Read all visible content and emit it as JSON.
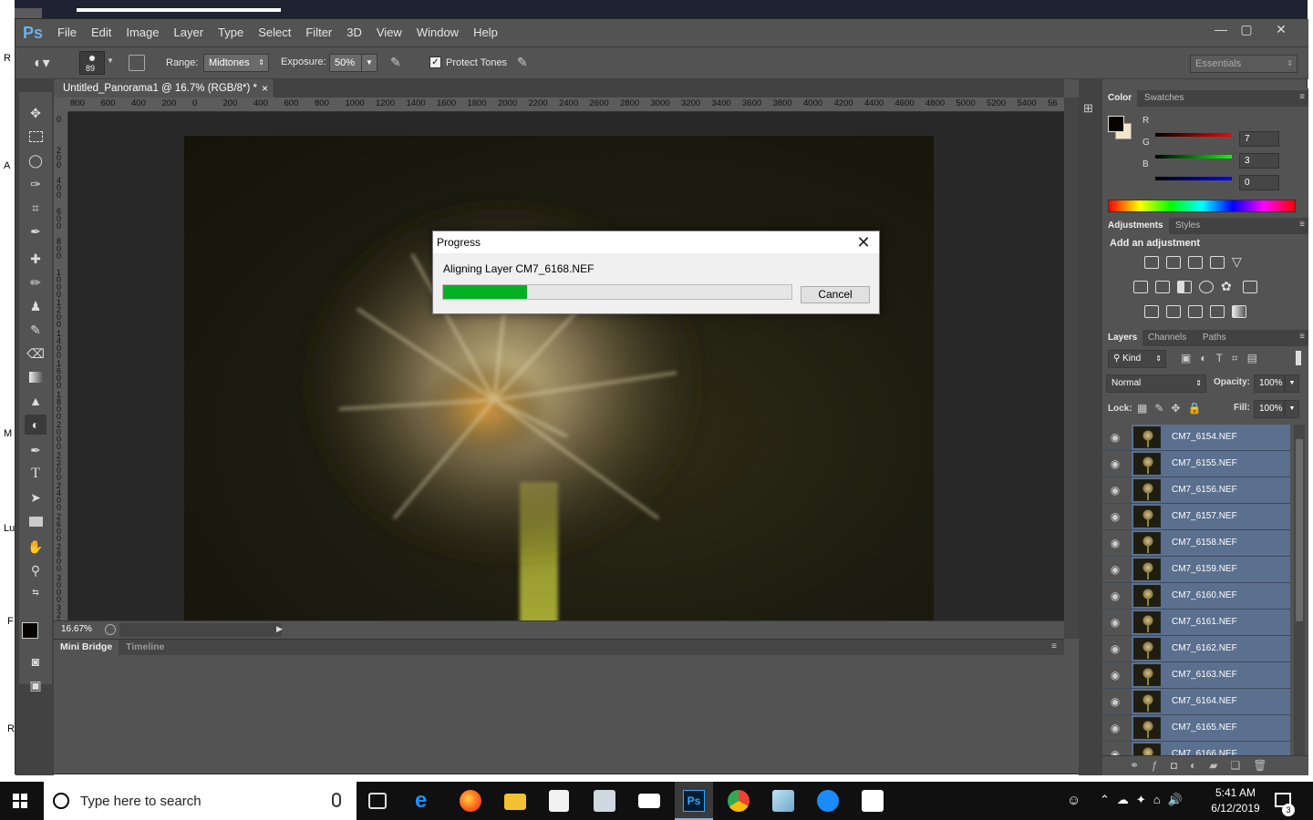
{
  "app": {
    "logo": "Ps",
    "menu": [
      "File",
      "Edit",
      "Image",
      "Layer",
      "Type",
      "Select",
      "Filter",
      "3D",
      "View",
      "Window",
      "Help"
    ],
    "window_controls": {
      "minimize": "—",
      "maximize": "▢",
      "close": "✕"
    }
  },
  "options_bar": {
    "brush_size": "89",
    "range_label": "Range:",
    "range_value": "Midtones",
    "exposure_label": "Exposure:",
    "exposure_value": "50%",
    "protect_tones_label": "Protect Tones",
    "protect_tones_checked": true,
    "workspace": "Essentials"
  },
  "document": {
    "tab_title": "Untitled_Panorama1 @ 16.7% (RGB/8*) *",
    "tab_close": "×",
    "zoom": "16.67%",
    "ruler_h": [
      "800",
      "600",
      "400",
      "200",
      "0",
      "200",
      "400",
      "600",
      "800",
      "1000",
      "1200",
      "1400",
      "1600",
      "1800",
      "2000",
      "2200",
      "2400",
      "2600",
      "2800",
      "3000",
      "3200",
      "3400",
      "3600",
      "3800",
      "4000",
      "4200",
      "4400",
      "4600",
      "4800",
      "5000",
      "5200",
      "5400",
      "56"
    ],
    "ruler_v": [
      "0",
      "200",
      "400",
      "600",
      "800",
      "1000",
      "1200",
      "1400",
      "1600",
      "1800",
      "2000",
      "2200",
      "2400",
      "2600",
      "2800",
      "3000",
      "3200"
    ]
  },
  "bottom_panel": {
    "tabs": [
      "Mini Bridge",
      "Timeline"
    ]
  },
  "color_panel": {
    "tabs": [
      "Color",
      "Swatches"
    ],
    "r_label": "R",
    "g_label": "G",
    "b_label": "B",
    "r": "7",
    "g": "3",
    "b": "0",
    "fg_color": "#070300",
    "bg_color": "#f0e6c8"
  },
  "adjustments_panel": {
    "tabs": [
      "Adjustments",
      "Styles"
    ],
    "heading": "Add an adjustment"
  },
  "layers_panel": {
    "tabs": [
      "Layers",
      "Channels",
      "Paths"
    ],
    "kind": "Kind",
    "blend_mode": "Normal",
    "opacity_label": "Opacity:",
    "opacity": "100%",
    "lock_label": "Lock:",
    "fill_label": "Fill:",
    "fill": "100%",
    "layers": [
      "CM7_6154.NEF",
      "CM7_6155.NEF",
      "CM7_6156.NEF",
      "CM7_6157.NEF",
      "CM7_6158.NEF",
      "CM7_6159.NEF",
      "CM7_6160.NEF",
      "CM7_6161.NEF",
      "CM7_6162.NEF",
      "CM7_6163.NEF",
      "CM7_6164.NEF",
      "CM7_6165.NEF",
      "CM7_6166.NEF"
    ]
  },
  "progress_dialog": {
    "title": "Progress",
    "message": "Aligning Layer CM7_6168.NEF",
    "progress": 0.24,
    "cancel_label": "Cancel",
    "bar_color": "#06b025"
  },
  "taskbar": {
    "search_placeholder": "Type here to search",
    "time": "5:41 AM",
    "date": "6/12/2019",
    "notification_count": "3"
  },
  "desktop_edge_letters": [
    "R",
    "A",
    "M",
    "Lu",
    "F",
    "R"
  ]
}
